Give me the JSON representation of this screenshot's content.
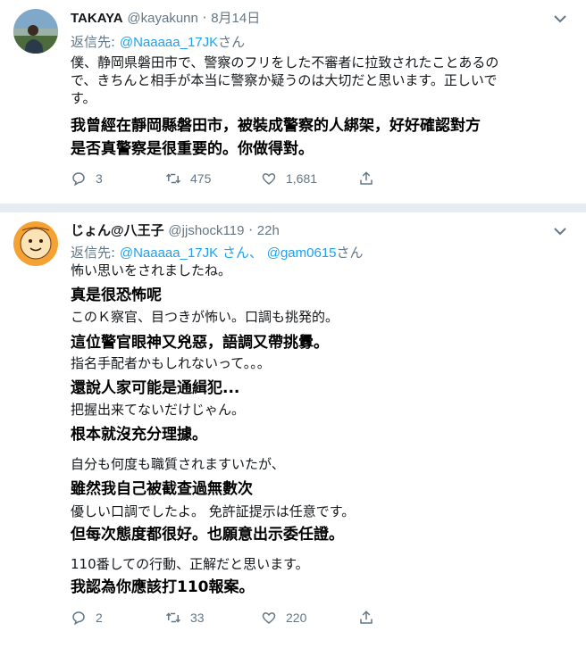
{
  "tweets": [
    {
      "name": "TAKAYA",
      "handle": "@kayakunn",
      "sep": "·",
      "date": "8月14日",
      "reply_prefix": "返信先:",
      "mention1": "@Naaaaa_17JK",
      "mention1_suffix": "さん",
      "jp_lines": [
        "僕、静岡県磐田市で、警察のフリをした不審者に拉致されたことあるの",
        "で、きちんと相手が本当に警察か疑うのは大切だと思います。正しいで",
        "す。"
      ],
      "zh_lines": [
        "我曾經在靜岡縣磐田市，被裝成警察的人綁架，好好確認對方",
        "是否真警察是很重要的。你做得對。"
      ],
      "replies": "3",
      "retweets": "475",
      "likes": "1,681"
    },
    {
      "name": "じょん@八王子",
      "handle": "@jjshock119",
      "sep": "·",
      "date": "22h",
      "reply_prefix": "返信先:",
      "mention1": "@Naaaaa_17JK",
      "mention1_suffix": "さん、",
      "mention2": "@gam0615",
      "mention2_suffix": "さん",
      "blocks": [
        {
          "jp": "怖い思いをされましたね。",
          "zh": "真是很恐怖呢"
        },
        {
          "jp": "このＫ察官、目つきが怖い。口調も挑発的。",
          "zh": "這位警官眼神又兇惡，語調又帶挑釁。"
        },
        {
          "jp": "指名手配者かもしれないって。。。",
          "zh": "還說人家可能是通緝犯..."
        },
        {
          "jp": "把握出来てないだけじゃん。",
          "zh": "根本就沒充分理據。"
        },
        {
          "jp": "自分も何度も職質されますいたが、",
          "zh": "雖然我自己被截查過無數次"
        },
        {
          "jp": "優しい口調でしたよ。 免許証提示は任意です。",
          "zh": "但每次態度都很好。也願意出示委任證。"
        },
        {
          "jp": "110番しての行動、正解だと思います。",
          "zh": "我認為你應該打110報案。"
        }
      ],
      "replies": "2",
      "retweets": "33",
      "likes": "220"
    }
  ],
  "icons": {
    "reply": "reply-icon",
    "retweet": "retweet-icon",
    "like": "heart-icon",
    "share": "share-icon",
    "more": "chevron-down-icon"
  },
  "colors": {
    "link": "#1da1f2",
    "muted": "#657786",
    "divider": "#e6ecf0"
  }
}
